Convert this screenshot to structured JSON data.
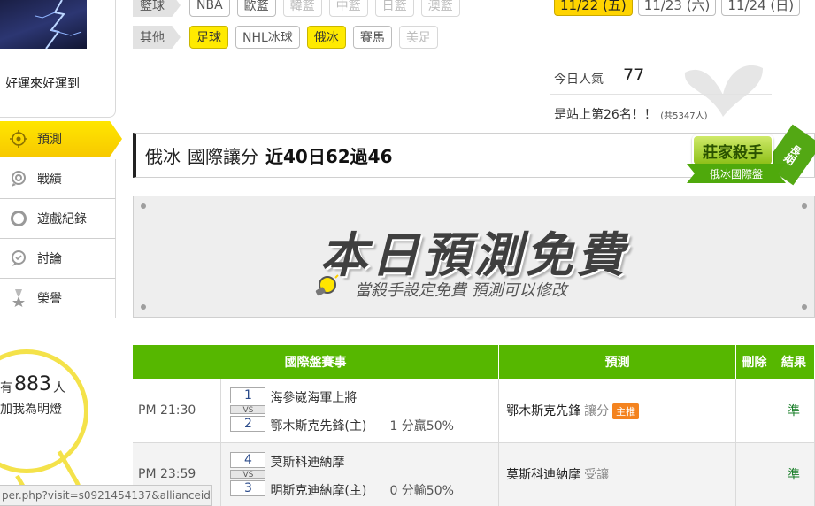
{
  "sidebar": {
    "motto": "好運來好運到",
    "nav": [
      {
        "label": "預測",
        "icon": "target-icon"
      },
      {
        "label": "戰績",
        "icon": "record-icon"
      },
      {
        "label": "遊戲紀錄",
        "icon": "circle-icon"
      },
      {
        "label": "討論",
        "icon": "chat-icon"
      },
      {
        "label": "榮譽",
        "icon": "medal-icon"
      }
    ],
    "fans": {
      "prefix": "有",
      "count": "883",
      "suffix": "人",
      "text": "加我為明燈"
    }
  },
  "filters": {
    "row1": {
      "label": "籃球",
      "items": [
        {
          "label": "NBA",
          "state": "normal"
        },
        {
          "label": "歐籃",
          "state": "normal"
        },
        {
          "label": "韓籃",
          "state": "disabled"
        },
        {
          "label": "中籃",
          "state": "disabled"
        },
        {
          "label": "日籃",
          "state": "disabled"
        },
        {
          "label": "澳籃",
          "state": "disabled"
        }
      ]
    },
    "row2": {
      "label": "其他",
      "items": [
        {
          "label": "足球",
          "state": "active"
        },
        {
          "label": "NHL冰球",
          "state": "normal"
        },
        {
          "label": "俄冰",
          "state": "active"
        },
        {
          "label": "賽馬",
          "state": "normal"
        },
        {
          "label": "美足",
          "state": "disabled"
        }
      ]
    }
  },
  "dates": [
    {
      "label": "11/22 (五)",
      "active": true
    },
    {
      "label": "11/23 (六)",
      "active": false
    },
    {
      "label": "11/24 (日)",
      "active": false
    }
  ],
  "popularity": {
    "label": "今日人氣",
    "value": "77"
  },
  "rank": {
    "text": "是站上第26名！！",
    "total": "(共5347人)"
  },
  "title": {
    "sport": "俄冰",
    "type": "國際讓分",
    "record": "近40日62過46"
  },
  "killer_badge": {
    "main": "莊家殺手",
    "ribbon": "俄冰國際盤",
    "tag": "長期"
  },
  "banner": {
    "title": "本日預測免費",
    "subtitle": "當殺手設定免費 預測可以修改"
  },
  "table": {
    "headers": [
      "國際盤賽事",
      "預測",
      "刪除",
      "結果"
    ],
    "rows": [
      {
        "time": "PM 21:30",
        "away_no": "1",
        "vs": "VS",
        "home_no": "2",
        "away": "海參崴海軍上將",
        "home": "鄂木斯克先鋒(主)",
        "handicap": "1 分贏50%",
        "pick": "鄂木斯克先鋒",
        "pick_type": "讓分",
        "badge": "主推",
        "result": "準"
      },
      {
        "time": "PM 23:59",
        "away_no": "4",
        "vs": "VS",
        "home_no": "3",
        "away": "莫斯科迪納摩",
        "home": "明斯克迪納摩(主)",
        "handicap": "0 分輸50%",
        "pick": "莫斯科迪納摩",
        "pick_type": "受讓",
        "badge": "",
        "result": "準"
      }
    ]
  },
  "status_url": "per.php?visit=s0921454137&allianceid=..."
}
